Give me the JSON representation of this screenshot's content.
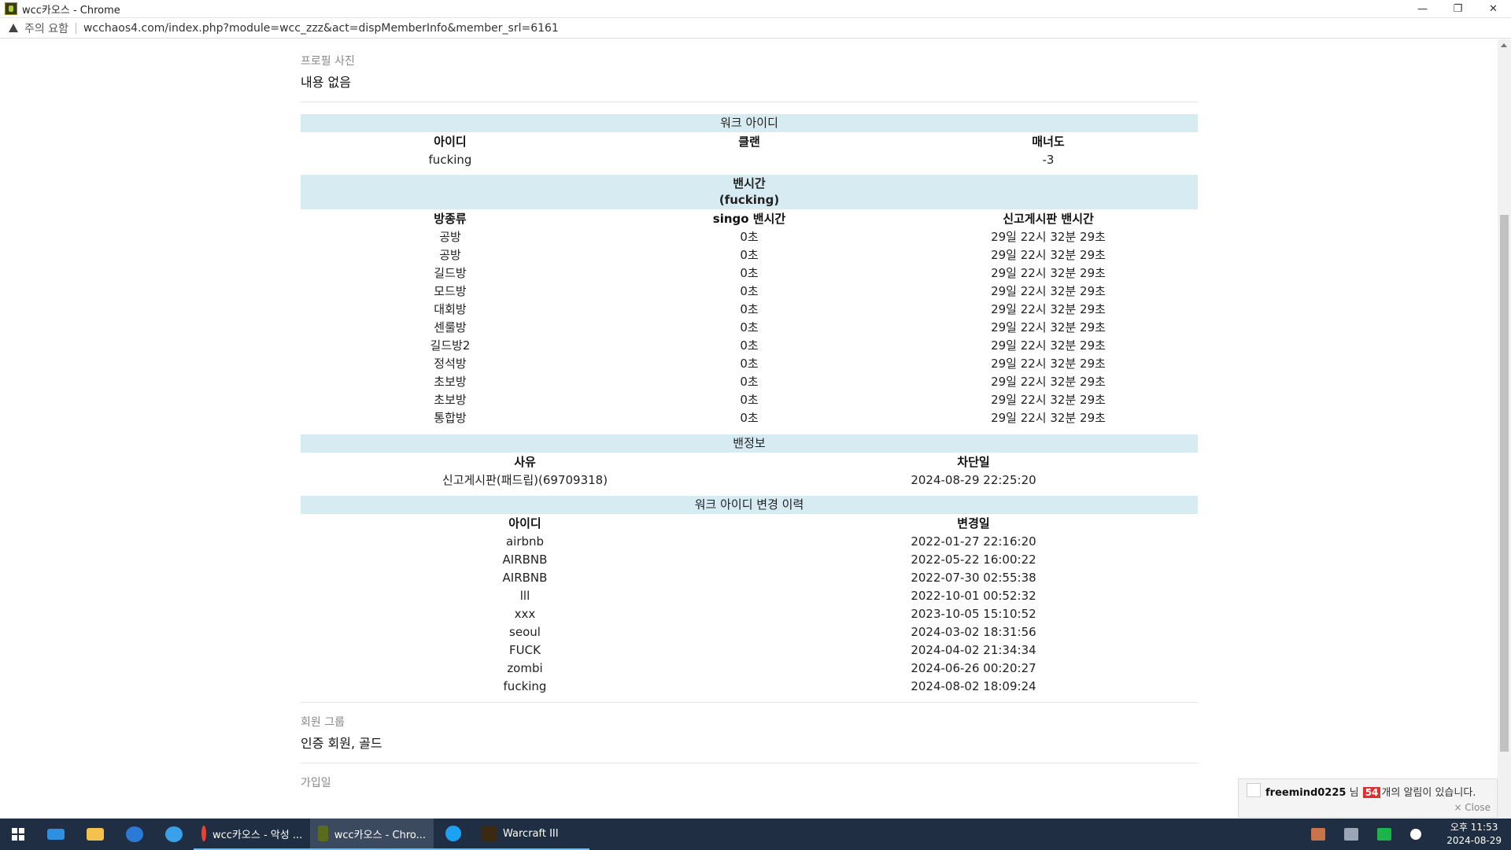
{
  "window": {
    "title": "wcc카오스 - Chrome",
    "minimize": "—",
    "restore": "❐",
    "close": "✕"
  },
  "addressbar": {
    "security_label": "주의 요함",
    "url": "wcchaos4.com/index.php?module=wcc_zzz&act=dispMemberInfo&member_srl=6161"
  },
  "profile": {
    "photo_label": "프로필 사진",
    "photo_value": "내용 없음",
    "group_label": "회원 그룹",
    "group_value": "인증 회원, 골드",
    "joined_label": "가입일"
  },
  "war3_id": {
    "title": "워크 아이디",
    "headers": [
      "아이디",
      "클랜",
      "매너도"
    ],
    "row": [
      "fucking",
      "",
      "-3"
    ]
  },
  "ban_time": {
    "title": "밴시간",
    "subtitle": "(fucking)",
    "headers": [
      "방종류",
      "singo 밴시간",
      "신고게시판 밴시간"
    ],
    "rows": [
      [
        "공방",
        "0초",
        "29일 22시 32분 29초"
      ],
      [
        "공방",
        "0초",
        "29일 22시 32분 29초"
      ],
      [
        "길드방",
        "0초",
        "29일 22시 32분 29초"
      ],
      [
        "모드방",
        "0초",
        "29일 22시 32분 29초"
      ],
      [
        "대회방",
        "0초",
        "29일 22시 32분 29초"
      ],
      [
        "센룰방",
        "0초",
        "29일 22시 32분 29초"
      ],
      [
        "길드방2",
        "0초",
        "29일 22시 32분 29초"
      ],
      [
        "정석방",
        "0초",
        "29일 22시 32분 29초"
      ],
      [
        "초보방",
        "0초",
        "29일 22시 32분 29초"
      ],
      [
        "초보방",
        "0초",
        "29일 22시 32분 29초"
      ],
      [
        "통합방",
        "0초",
        "29일 22시 32분 29초"
      ]
    ]
  },
  "ban_info": {
    "title": "밴정보",
    "headers": [
      "사유",
      "차단일"
    ],
    "rows": [
      [
        "신고게시판(패드립)(69709318)",
        "2024-08-29 22:25:20"
      ]
    ]
  },
  "id_history": {
    "title": "워크 아이디 변경 이력",
    "headers": [
      "아이디",
      "변경일"
    ],
    "rows": [
      [
        "airbnb",
        "2022-01-27 22:16:20"
      ],
      [
        "AIRBNB",
        "2022-05-22 16:00:22"
      ],
      [
        "AIRBNB",
        "2022-07-30 02:55:38"
      ],
      [
        "lll",
        "2022-10-01 00:52:32"
      ],
      [
        "xxx",
        "2023-10-05 15:10:52"
      ],
      [
        "seoul",
        "2024-03-02 18:31:56"
      ],
      [
        "FUCK",
        "2024-04-02 21:34:34"
      ],
      [
        "zombi",
        "2024-06-26 00:20:27"
      ],
      [
        "fucking",
        "2024-08-02 18:09:24"
      ]
    ]
  },
  "notification": {
    "user": "freemind0225",
    "honorific": "님",
    "count": "54",
    "message": "개의 알림이 있습니다.",
    "close": "× Close"
  },
  "taskbar": {
    "apps": [
      {
        "label": "wcc카오스 - 악성 ...",
        "color": "#4285f4"
      },
      {
        "label": "wcc카오스 - Chro...",
        "color": "#5a6b1e"
      },
      {
        "label": "",
        "color": "#1da1f2"
      },
      {
        "label": "Warcraft III",
        "color": "#3a2a14"
      }
    ],
    "clock_time": "오후 11:53",
    "clock_date": "2024-08-29"
  },
  "colors": {
    "section_header_bg": "#d7ebf2",
    "taskbar_bg": "#1f2e42",
    "badge": "#e03030"
  }
}
